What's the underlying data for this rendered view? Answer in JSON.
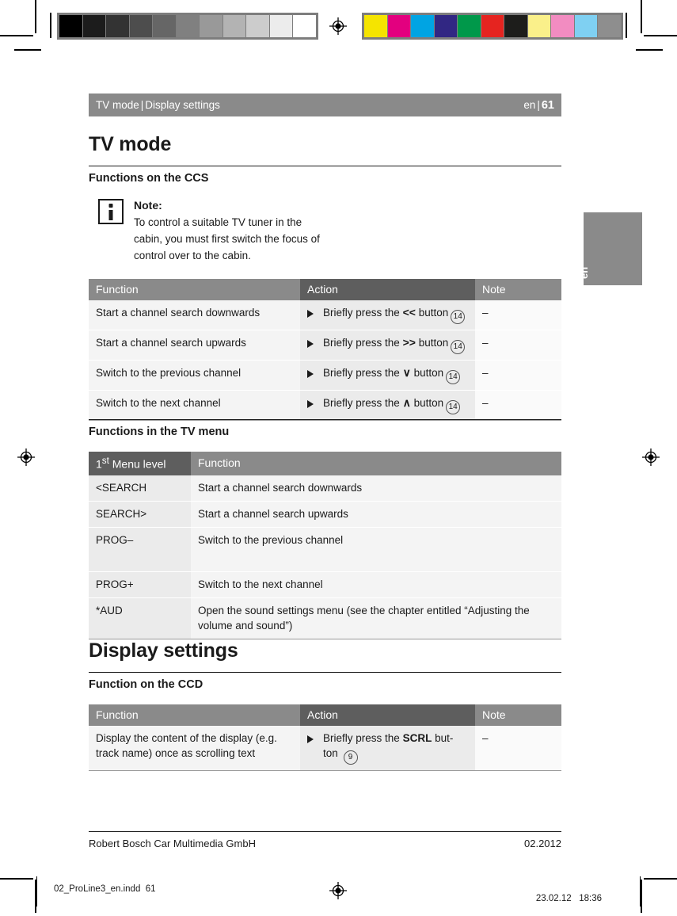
{
  "header": {
    "breadcrumb_left": "TV mode",
    "breadcrumb_sep": "|",
    "breadcrumb_right": "Display settings",
    "lang": "en",
    "page_sep": "|",
    "page_number": "61"
  },
  "side_tab": {
    "label": "en"
  },
  "sections": {
    "tv_mode": {
      "title": "TV mode",
      "sub_ccs": "Functions on the CCS",
      "sub_tv_menu": "Functions in the TV menu"
    },
    "display_settings": {
      "title": "Display settings",
      "sub_ccd": "Function on the CCD"
    }
  },
  "note": {
    "icon": "info-icon",
    "heading": "Note:",
    "body": "To control a suitable TV tuner in the cabin, you must first switch the focus of control over to the cabin."
  },
  "table_ccs": {
    "headers": [
      "Function",
      "Action",
      "Note"
    ],
    "rows": [
      {
        "function": "Start a channel search downwards",
        "action_prefix": "Briefly press the",
        "action_key": "<<",
        "action_suffix": "button",
        "badge": "14",
        "note": "–"
      },
      {
        "function": "Start a channel search upwards",
        "action_prefix": "Briefly press the",
        "action_key": ">>",
        "action_suffix": "button",
        "badge": "14",
        "note": "–"
      },
      {
        "function": "Switch to the previous channel",
        "action_prefix": "Briefly press the",
        "action_key": "∨",
        "action_suffix": "button",
        "badge": "14",
        "note": "–"
      },
      {
        "function": "Switch to the next channel",
        "action_prefix": "Briefly press the",
        "action_key": "∧",
        "action_suffix": "button",
        "badge": "14",
        "note": "–"
      }
    ]
  },
  "table_tv_menu": {
    "headers": [
      "1st Menu level",
      "Function"
    ],
    "header_menu_level_num": "1",
    "header_menu_level_sup": "st",
    "header_menu_level_rest": "Menu level",
    "rows": [
      {
        "level": "<SEARCH",
        "function": "Start a channel search downwards"
      },
      {
        "level": "SEARCH>",
        "function": "Start a channel search upwards"
      },
      {
        "level": "PROG–",
        "function": "Switch to the previous channel"
      },
      {
        "level": "PROG+",
        "function": "Switch to the next channel"
      },
      {
        "level": "*AUD",
        "function": "Open the sound settings menu (see the chapter entitled “Adjusting the volume and sound”)"
      }
    ]
  },
  "table_ccd": {
    "headers": [
      "Function",
      "Action",
      "Note"
    ],
    "rows": [
      {
        "function": "Display the content of the display (e.g. track name) once as scrolling text",
        "action_prefix": "Briefly press the",
        "action_key": "SCRL",
        "action_suffix": "but-ton",
        "badge": "9",
        "note": "–"
      }
    ]
  },
  "footer": {
    "company": "Robert Bosch Car Multimedia GmbH",
    "date": "02.2012"
  },
  "print_bar": {
    "file_name": "02_ProLine3_en.indd",
    "file_page": "61",
    "date": "23.02.12",
    "time": "18:36",
    "registration_icon": "registration-target-icon"
  },
  "calibration": {
    "grayscale_label": "grayscale-step-wedge",
    "grayscale_swatches": [
      "#000000",
      "#1c1c1c",
      "#333333",
      "#4d4d4d",
      "#666666",
      "#808080",
      "#999999",
      "#b3b3b3",
      "#cccccc",
      "#ececec",
      "#ffffff"
    ],
    "color_label": "process-color-bar",
    "color_swatches": [
      "#f5e400",
      "#e3007f",
      "#00a4e3",
      "#312783",
      "#00984a",
      "#e52420",
      "#1d1d1b",
      "#faf08a",
      "#f28cc1",
      "#7fd0f2",
      "#8e8e8e"
    ]
  }
}
